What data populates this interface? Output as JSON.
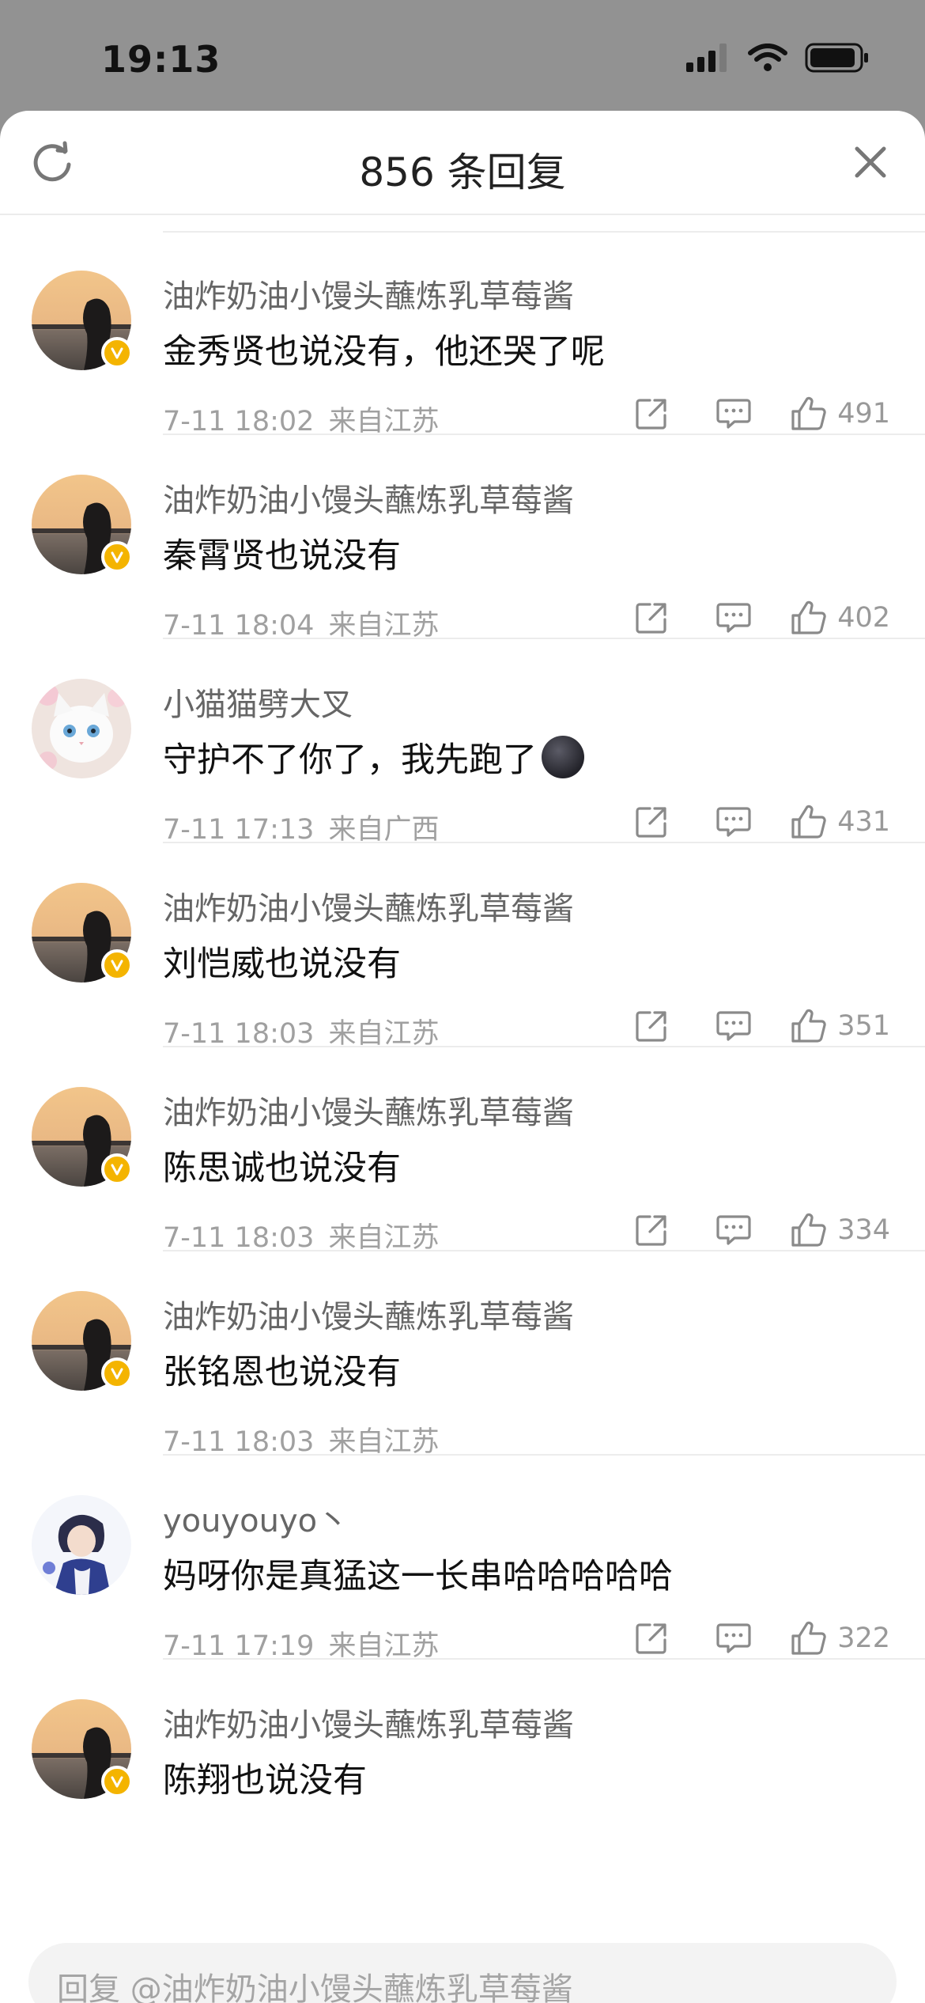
{
  "status_bar": {
    "time": "19:13"
  },
  "header": {
    "title": "856 条回复"
  },
  "comments": [
    {
      "username": "油炸奶油小馒头蘸炼乳草莓酱",
      "text": "金秀贤也说没有，他还哭了呢",
      "date": "7-11 18:02",
      "location": "来自江苏",
      "likes": "491",
      "verified": true,
      "avatar": "sunset"
    },
    {
      "username": "油炸奶油小馒头蘸炼乳草莓酱",
      "text": "秦霄贤也说没有",
      "date": "7-11 18:04",
      "location": "来自江苏",
      "likes": "402",
      "verified": true,
      "avatar": "sunset"
    },
    {
      "username": "小猫猫劈大叉",
      "text": "守护不了你了，我先跑了",
      "date": "7-11 17:13",
      "location": "来自广西",
      "likes": "431",
      "verified": false,
      "avatar": "cat",
      "emoji": "new-moon-face"
    },
    {
      "username": "油炸奶油小馒头蘸炼乳草莓酱",
      "text": "刘恺威也说没有",
      "date": "7-11 18:03",
      "location": "来自江苏",
      "likes": "351",
      "verified": true,
      "avatar": "sunset"
    },
    {
      "username": "油炸奶油小馒头蘸炼乳草莓酱",
      "text": "陈思诚也说没有",
      "date": "7-11 18:03",
      "location": "来自江苏",
      "likes": "334",
      "verified": true,
      "avatar": "sunset"
    },
    {
      "username": "油炸奶油小馒头蘸炼乳草莓酱",
      "text": "张铭恩也说没有",
      "date": "7-11 18:03",
      "location": "来自江苏",
      "likes": "",
      "verified": true,
      "avatar": "sunset",
      "actions_obscured": true
    },
    {
      "username": "youyouyo丶",
      "text": "妈呀你是真猛这一长串哈哈哈哈哈",
      "date": "7-11 17:19",
      "location": "来自江苏",
      "likes": "322",
      "verified": false,
      "avatar": "anime"
    },
    {
      "username": "油炸奶油小馒头蘸炼乳草莓酱",
      "text": "陈翔也说没有",
      "date": "",
      "location": "",
      "likes": "",
      "verified": true,
      "avatar": "sunset"
    }
  ],
  "reply_input": {
    "placeholder": "回复 @油炸奶油小馒头蘸炼乳草莓酱"
  },
  "colors": {
    "verified_badge": "#f4b400",
    "sheet_bg": "#ffffff",
    "overlay": "#929292"
  },
  "icons": [
    "refresh-icon",
    "close-icon",
    "share-icon",
    "comment-icon",
    "like-icon",
    "verified-icon",
    "signal-icon",
    "wifi-icon",
    "battery-icon"
  ]
}
